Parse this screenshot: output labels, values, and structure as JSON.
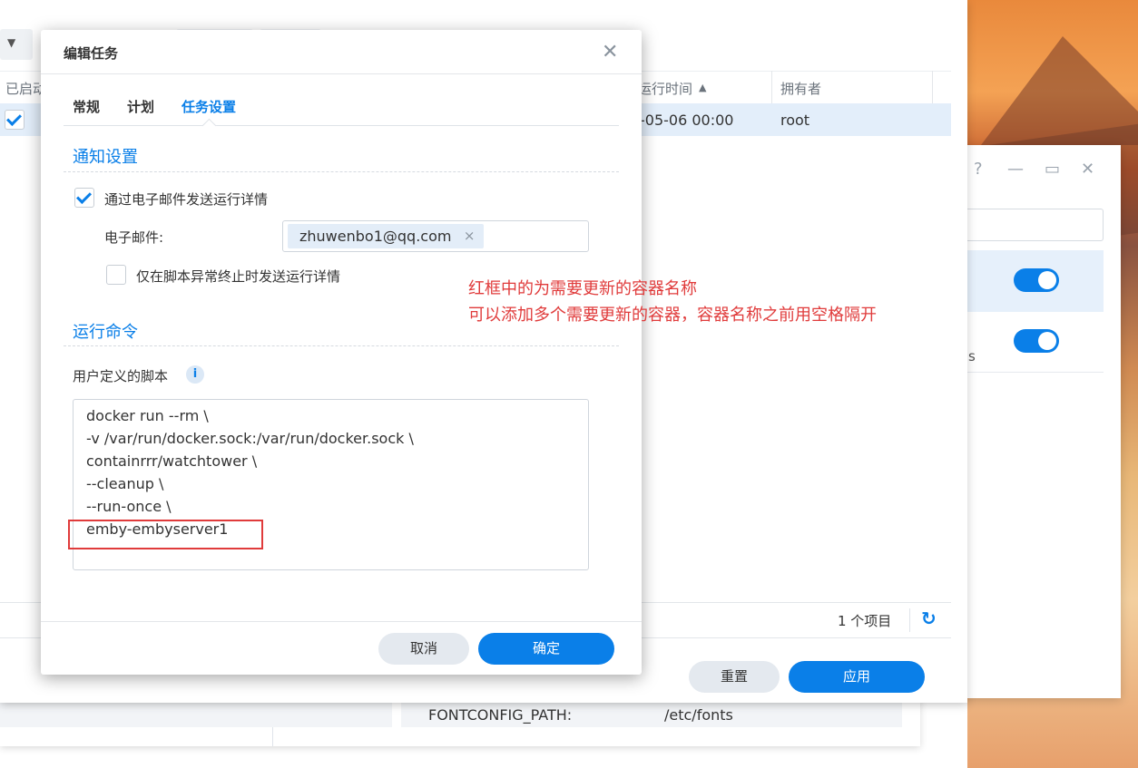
{
  "main_window": {
    "columns": {
      "enabled": "已启动",
      "run_time": "运行时间",
      "owner": "拥有者"
    },
    "row": {
      "run_time": "-05-06 00:00",
      "owner": "root"
    },
    "footer": {
      "count": "1 个项目"
    },
    "buttons": {
      "reset": "重置",
      "apply": "应用"
    },
    "sort_indicator": "▲"
  },
  "mid_window": {
    "controls": {
      "help": "?",
      "minimize": "—",
      "maximize": "▭",
      "close": "✕"
    },
    "partial_text": "s"
  },
  "bottom_window": {
    "env_key": "FONTCONFIG_PATH:",
    "env_value": "/etc/fonts"
  },
  "dialog": {
    "title": "编辑任务",
    "close_glyph": "✕",
    "tabs": [
      {
        "label": "常规",
        "active": false
      },
      {
        "label": "计划",
        "active": false
      },
      {
        "label": "任务设置",
        "active": true
      }
    ],
    "notification": {
      "heading": "通知设置",
      "send_email_label": "通过电子邮件发送运行详情",
      "send_email_checked": true,
      "email_label": "电子邮件:",
      "email_value": "zhuwenbo1@qq.com",
      "chip_remove": "×",
      "only_on_error_label": "仅在脚本异常终止时发送运行详情",
      "only_on_error_checked": false
    },
    "command": {
      "heading": "运行命令",
      "script_label": "用户定义的脚本",
      "info_glyph": "i",
      "script_lines": [
        "docker run --rm \\",
        "-v /var/run/docker.sock:/var/run/docker.sock \\",
        "containrrr/watchtower \\",
        "--cleanup \\",
        "--run-once \\",
        "emby-embyserver1"
      ]
    },
    "buttons": {
      "cancel": "取消",
      "ok": "确定"
    }
  },
  "annotation": {
    "line1": "红框中的为需要更新的容器名称",
    "line2": "可以添加多个需要更新的容器，容器名称之前用空格隔开",
    "color": "#e03b3b"
  },
  "colors": {
    "accent": "#0a7fe8",
    "annotation": "#e03b3b"
  }
}
